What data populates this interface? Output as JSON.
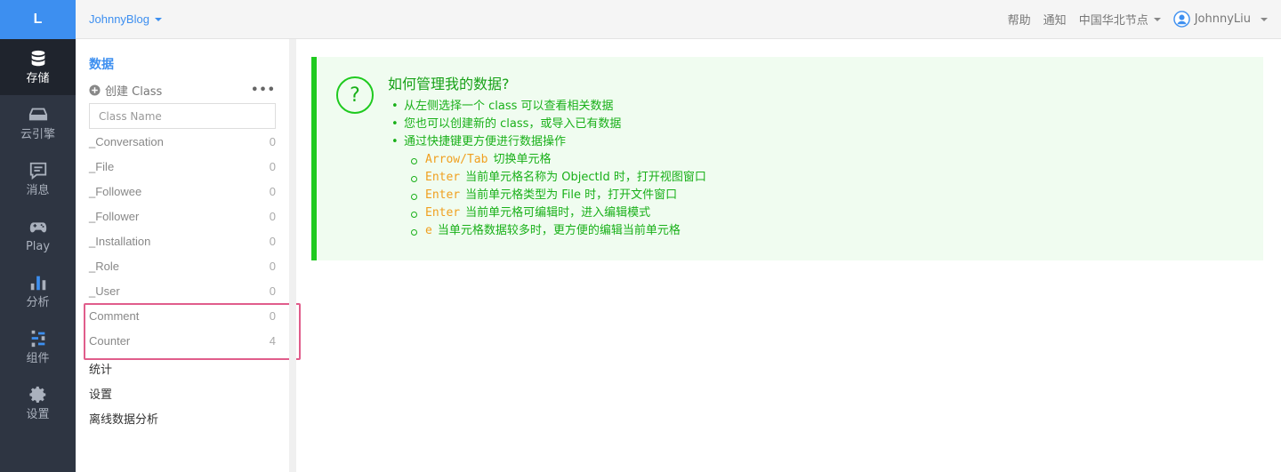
{
  "rail": {
    "logo": "L",
    "items": [
      {
        "label": "存储",
        "icon": "database-icon",
        "active": true
      },
      {
        "label": "云引擎",
        "icon": "server-icon",
        "active": false
      },
      {
        "label": "消息",
        "icon": "message-icon",
        "active": false
      },
      {
        "label": "Play",
        "icon": "gamepad-icon",
        "active": false
      },
      {
        "label": "分析",
        "icon": "bar-chart-icon",
        "active": false
      },
      {
        "label": "组件",
        "icon": "components-icon",
        "active": false
      },
      {
        "label": "设置",
        "icon": "gear-icon",
        "active": false
      }
    ]
  },
  "topbar": {
    "app_name": "JohnnyBlog",
    "help": "帮助",
    "notify": "通知",
    "region": "中国华北节点",
    "user": "JohnnyLiu"
  },
  "panel": {
    "section_title": "数据",
    "create_label": "创建 Class",
    "more": "•••",
    "search_placeholder": "Class Name",
    "classes": [
      {
        "name": "_Conversation",
        "count": "0"
      },
      {
        "name": "_File",
        "count": "0"
      },
      {
        "name": "_Followee",
        "count": "0"
      },
      {
        "name": "_Follower",
        "count": "0"
      },
      {
        "name": "_Installation",
        "count": "0"
      },
      {
        "name": "_Role",
        "count": "0"
      },
      {
        "name": "_User",
        "count": "0"
      },
      {
        "name": "Comment",
        "count": "0"
      },
      {
        "name": "Counter",
        "count": "4"
      }
    ],
    "nav": [
      "统计",
      "设置",
      "离线数据分析"
    ]
  },
  "help": {
    "icon": "?",
    "title": "如何管理我的数据?",
    "items": [
      "从左侧选择一个 class 可以查看相关数据",
      "您也可以创建新的 class，或导入已有数据",
      "通过快捷键更方便进行数据操作"
    ],
    "shortcuts": [
      {
        "key": "Arrow/Tab",
        "desc": "切换单元格"
      },
      {
        "key": "Enter",
        "desc": "当前单元格名称为 ObjectId 时，打开视图窗口"
      },
      {
        "key": "Enter",
        "desc": "当前单元格类型为 File 时，打开文件窗口"
      },
      {
        "key": "Enter",
        "desc": "当前单元格可编辑时，进入编辑模式"
      },
      {
        "key": "e",
        "desc": "当单元格数据较多时，更方便的编辑当前单元格"
      }
    ]
  },
  "colors": {
    "accent": "#3d8ff0",
    "rail_bg": "#2e3542",
    "help_green": "#1fca1f",
    "key_orange": "#f0a020",
    "highlight": "#e05d8b"
  }
}
